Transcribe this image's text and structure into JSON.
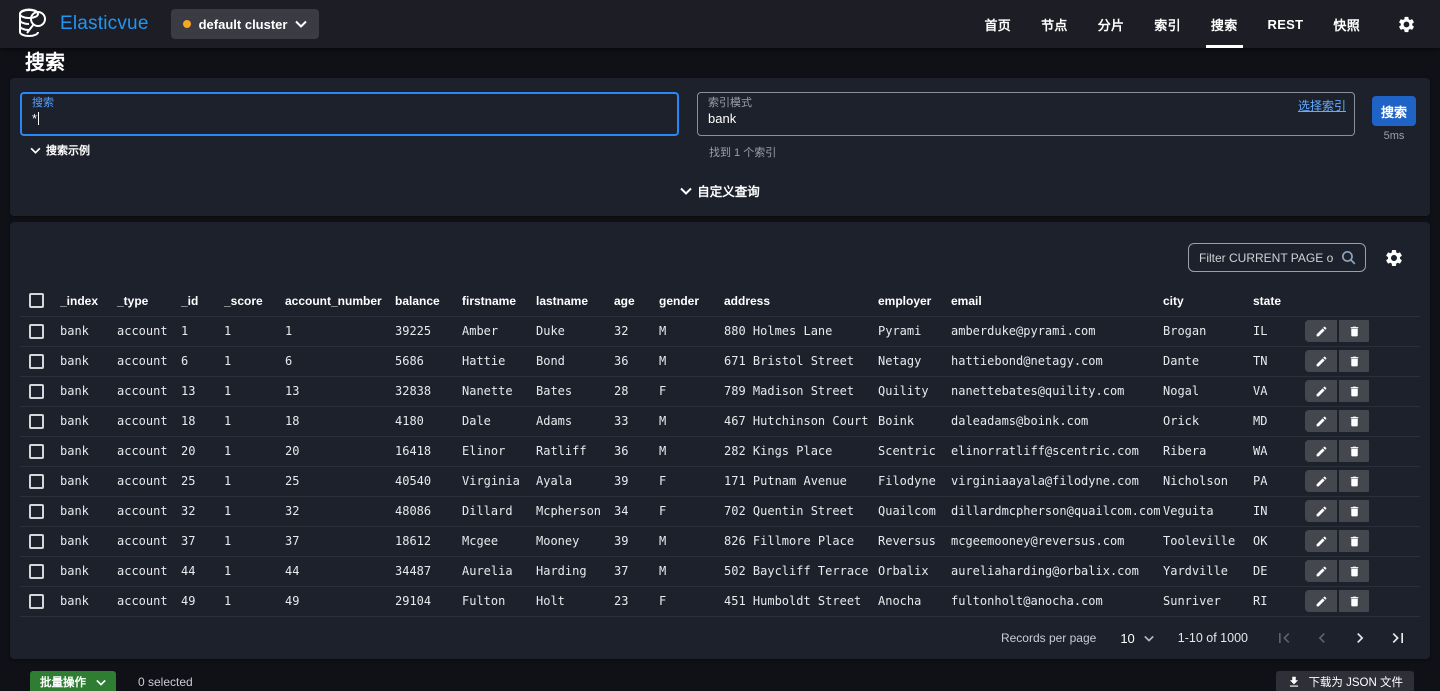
{
  "navbar": {
    "brand": "Elasticvue",
    "cluster_selector": "default cluster",
    "items": [
      {
        "label": "首页",
        "active": false
      },
      {
        "label": "节点",
        "active": false
      },
      {
        "label": "分片",
        "active": false
      },
      {
        "label": "索引",
        "active": false
      },
      {
        "label": "搜索",
        "active": true
      },
      {
        "label": "REST",
        "active": false
      },
      {
        "label": "快照",
        "active": false
      }
    ]
  },
  "page": {
    "title": "搜索"
  },
  "search_panel": {
    "query_label": "搜索",
    "query_value": "*",
    "examples_toggle": "搜索示例",
    "index_pattern_label": "索引模式",
    "index_pattern_value": "bank",
    "select_index_link": "选择索引",
    "search_button": "搜索",
    "search_time": "5ms",
    "indices_found": "找到 1 个索引",
    "custom_query_toggle": "自定义查询"
  },
  "results_panel": {
    "filter_placeholder": "Filter CURRENT PAGE only",
    "table": {
      "columns": [
        "_index",
        "_type",
        "_id",
        "_score",
        "account_number",
        "balance",
        "firstname",
        "lastname",
        "age",
        "gender",
        "address",
        "employer",
        "email",
        "city",
        "state"
      ],
      "rows": [
        [
          "bank",
          "account",
          "1",
          "1",
          "1",
          "39225",
          "Amber",
          "Duke",
          "32",
          "M",
          "880 Holmes Lane",
          "Pyrami",
          "amberduke@pyrami.com",
          "Brogan",
          "IL"
        ],
        [
          "bank",
          "account",
          "6",
          "1",
          "6",
          "5686",
          "Hattie",
          "Bond",
          "36",
          "M",
          "671 Bristol Street",
          "Netagy",
          "hattiebond@netagy.com",
          "Dante",
          "TN"
        ],
        [
          "bank",
          "account",
          "13",
          "1",
          "13",
          "32838",
          "Nanette",
          "Bates",
          "28",
          "F",
          "789 Madison Street",
          "Quility",
          "nanettebates@quility.com",
          "Nogal",
          "VA"
        ],
        [
          "bank",
          "account",
          "18",
          "1",
          "18",
          "4180",
          "Dale",
          "Adams",
          "33",
          "M",
          "467 Hutchinson Court",
          "Boink",
          "daleadams@boink.com",
          "Orick",
          "MD"
        ],
        [
          "bank",
          "account",
          "20",
          "1",
          "20",
          "16418",
          "Elinor",
          "Ratliff",
          "36",
          "M",
          "282 Kings Place",
          "Scentric",
          "elinorratliff@scentric.com",
          "Ribera",
          "WA"
        ],
        [
          "bank",
          "account",
          "25",
          "1",
          "25",
          "40540",
          "Virginia",
          "Ayala",
          "39",
          "F",
          "171 Putnam Avenue",
          "Filodyne",
          "virginiaayala@filodyne.com",
          "Nicholson",
          "PA"
        ],
        [
          "bank",
          "account",
          "32",
          "1",
          "32",
          "48086",
          "Dillard",
          "Mcpherson",
          "34",
          "F",
          "702 Quentin Street",
          "Quailcom",
          "dillardmcpherson@quailcom.com",
          "Veguita",
          "IN"
        ],
        [
          "bank",
          "account",
          "37",
          "1",
          "37",
          "18612",
          "Mcgee",
          "Mooney",
          "39",
          "M",
          "826 Fillmore Place",
          "Reversus",
          "mcgeemooney@reversus.com",
          "Tooleville",
          "OK"
        ],
        [
          "bank",
          "account",
          "44",
          "1",
          "44",
          "34487",
          "Aurelia",
          "Harding",
          "37",
          "M",
          "502 Baycliff Terrace",
          "Orbalix",
          "aureliaharding@orbalix.com",
          "Yardville",
          "DE"
        ],
        [
          "bank",
          "account",
          "49",
          "1",
          "49",
          "29104",
          "Fulton",
          "Holt",
          "23",
          "F",
          "451 Humboldt Street",
          "Anocha",
          "fultonholt@anocha.com",
          "Sunriver",
          "RI"
        ]
      ]
    },
    "pagination": {
      "records_per_page_label": "Records per page",
      "records_per_page_value": "10",
      "range_label": "1-10 of 1000"
    }
  },
  "footer": {
    "bulk_button": "批量操作",
    "selected_label": "0 selected",
    "download_button": "下载为 JSON 文件"
  },
  "colors": {
    "brand_blue": "#2196f3",
    "accent_link_blue": "#64a9ff",
    "search_button_blue": "#1f63c6",
    "focus_border_blue": "#2b87f5",
    "cluster_status_orange": "#f5a623",
    "bulk_button_green": "#2e7d32",
    "panel_background": "#1d212b",
    "page_background": "#101117"
  }
}
